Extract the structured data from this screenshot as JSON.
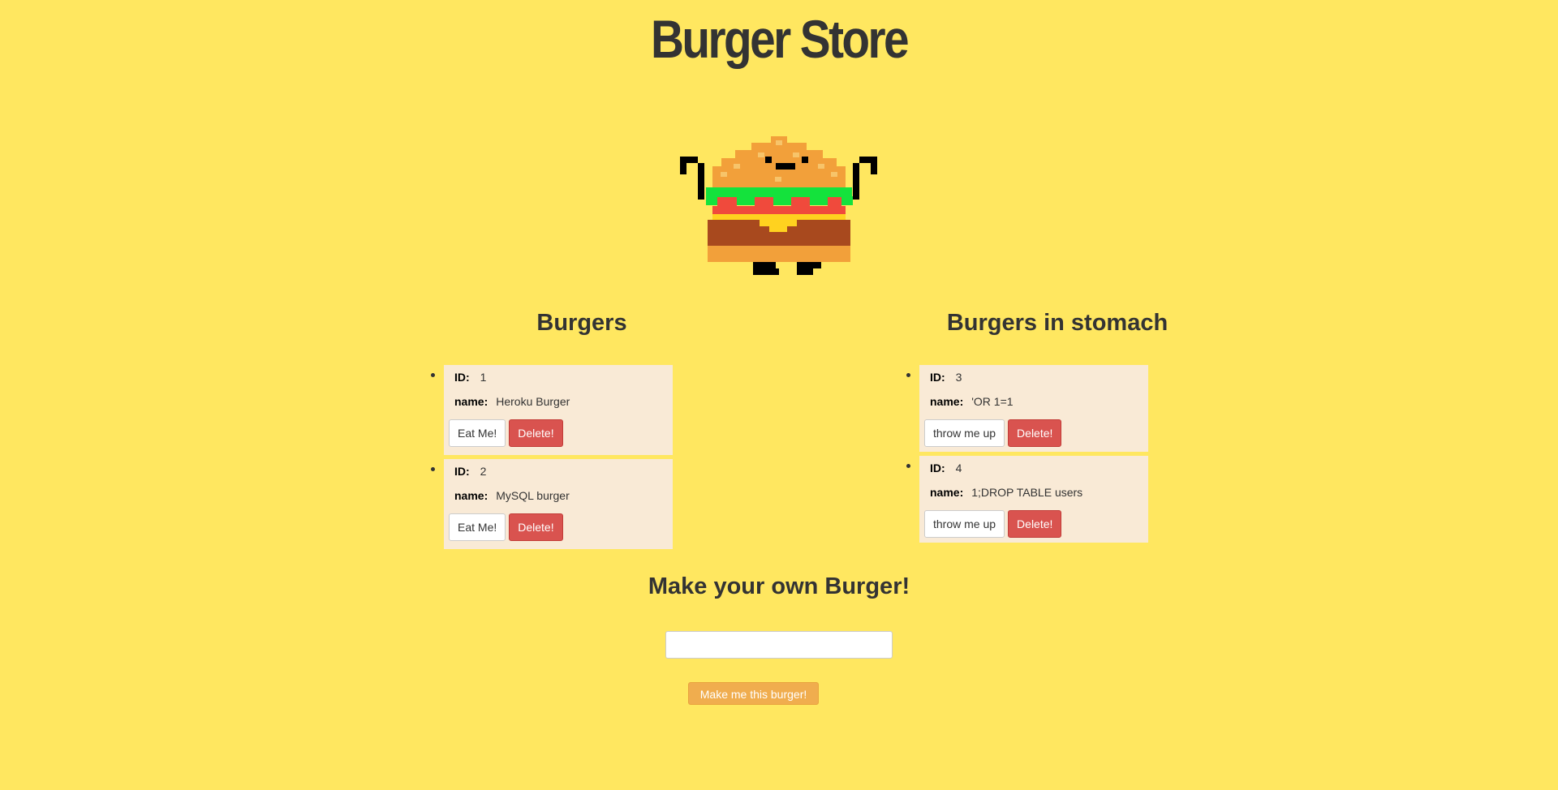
{
  "page": {
    "title": "Burger Store"
  },
  "mascot": {
    "icon": "pixel-burger-mascot-icon"
  },
  "burgers": {
    "heading": "Burgers",
    "id_label": "ID:",
    "name_label": "name:",
    "action_label": "Eat Me!",
    "delete_label": "Delete!",
    "items": [
      {
        "id": "1",
        "name": "Heroku Burger"
      },
      {
        "id": "2",
        "name": "MySQL burger"
      }
    ]
  },
  "stomach": {
    "heading": "Burgers in stomach",
    "id_label": "ID:",
    "name_label": "name:",
    "action_label": "throw me up",
    "delete_label": "Delete!",
    "items": [
      {
        "id": "3",
        "name": "'OR 1=1"
      },
      {
        "id": "4",
        "name": "1;DROP TABLE users"
      }
    ]
  },
  "create": {
    "heading": "Make your own Burger!",
    "input_value": "",
    "input_placeholder": "",
    "submit_label": "Make me this burger!"
  },
  "colors": {
    "background": "#ffe760",
    "card": "#f9ead6",
    "danger": "#d9534f",
    "warning": "#f0ad4e",
    "text": "#333333"
  }
}
